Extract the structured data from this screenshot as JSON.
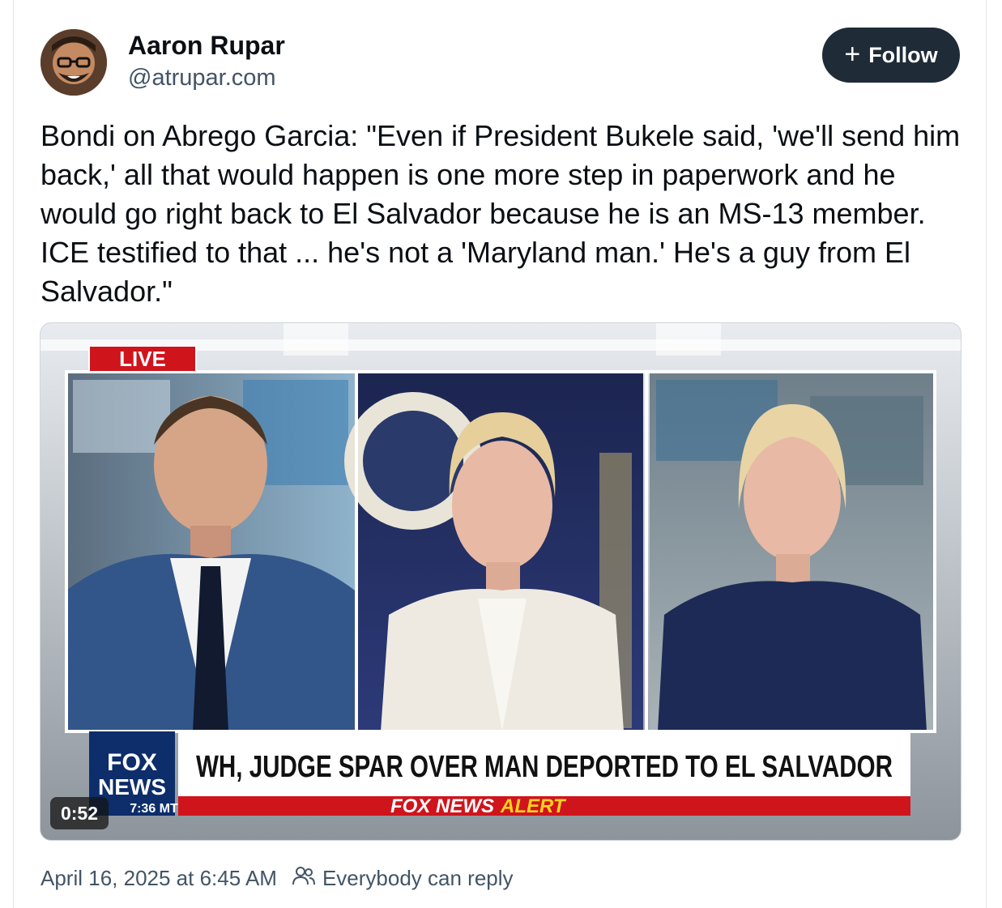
{
  "author": {
    "name": "Aaron Rupar",
    "handle": "@atrupar.com"
  },
  "follow_button": {
    "icon": "plus-icon",
    "label": "Follow"
  },
  "post": {
    "text": "Bondi on Abrego Garcia: \"Even if President Bukele said, 'we'll send him back,' all that would happen is one more step in paperwork and he would go right back to El Salvador because he is an MS-13 member. ICE testified to that ... he's not a 'Maryland man.' He's a guy from El Salvador.\""
  },
  "video": {
    "live_badge": "LIVE",
    "chyron_headline": "WH, JUDGE SPAR OVER MAN DEPORTED TO EL SALVADOR",
    "network_logo_top": "FOX",
    "network_logo_bottom": "NEWS",
    "clock": "7:36 MT",
    "alert_prefix": "FOX NEWS",
    "alert_word": "ALERT",
    "duration": "0:52"
  },
  "footer": {
    "timestamp": "April 16, 2025 at 6:45 AM",
    "reply_setting": "Everybody can reply",
    "reply_icon": "people-icon"
  },
  "colors": {
    "follow_bg": "#1f2b37",
    "muted_text": "#425466",
    "fox_red": "#d0141c",
    "fox_blue": "#0d2d6b",
    "alert_yellow": "#ffd21f"
  }
}
